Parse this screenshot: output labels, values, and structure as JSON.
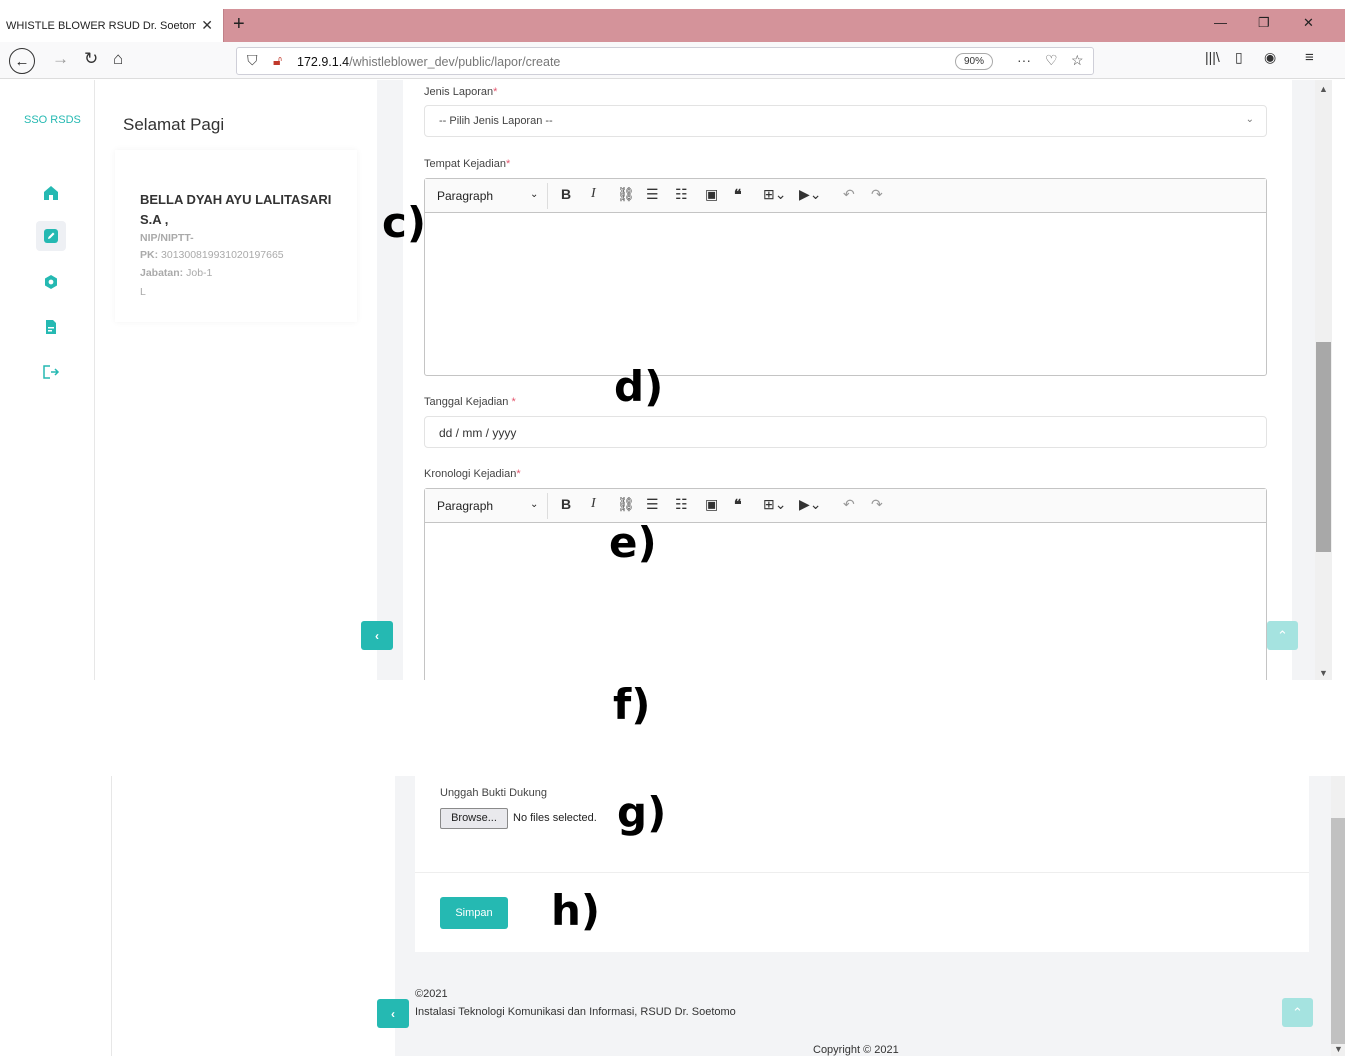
{
  "browser": {
    "tab_title": "WHISTLE BLOWER RSUD Dr. Soetomo",
    "tab_close": "✕",
    "new_tab": "+",
    "url_host": "172.9.1.4",
    "url_path": "/whistleblower_dev/public/lapor/create",
    "zoom": "90%"
  },
  "sidebar": {
    "brand": "SSO RSDS",
    "items": [
      {
        "icon": "home-icon",
        "active": false
      },
      {
        "icon": "edit-icon",
        "active": true
      },
      {
        "icon": "hexagon-icon",
        "active": false
      },
      {
        "icon": "document-icon",
        "active": false
      },
      {
        "icon": "logout-icon",
        "active": false
      }
    ]
  },
  "greeting": "Selamat Pagi",
  "profile": {
    "name": "BELLA DYAH AYU LALITASARI S.A ,",
    "nip_label": "NIP/NIPTT-",
    "pk_label": "PK:",
    "pk_value": "3013008199310201976​65",
    "jabatan_label": "Jabatan:",
    "jabatan_value": "Job-1",
    "extra": "L"
  },
  "form": {
    "jenis_label": "Jenis Laporan",
    "jenis_placeholder": "-- Pilih Jenis Laporan --",
    "tempat_label": "Tempat Kejadian",
    "tanggal_label": "Tanggal Kejadian",
    "tanggal_placeholder": "dd / mm / yyyy",
    "kronologi_label": "Kronologi Kejadian",
    "required_mark": "*",
    "editor_paragraph": "Paragraph",
    "upload_label": "Unggah Bukti Dukung",
    "browse_label": "Browse...",
    "no_file": "No files selected.",
    "submit_label": "Simpan"
  },
  "footer": {
    "year": "©2021",
    "org": "Instalasi Teknologi Komunikasi dan Informasi, RSUD Dr. Soetomo",
    "copyright": "Copyright © 2021"
  },
  "annotations": {
    "c": "c)",
    "d": "d)",
    "e": "e)",
    "f": "f)",
    "g": "g)",
    "h": "h)"
  },
  "colors": {
    "accent": "#25b9b2",
    "tab_bar": "#d4939a",
    "required": "#e4566e"
  }
}
